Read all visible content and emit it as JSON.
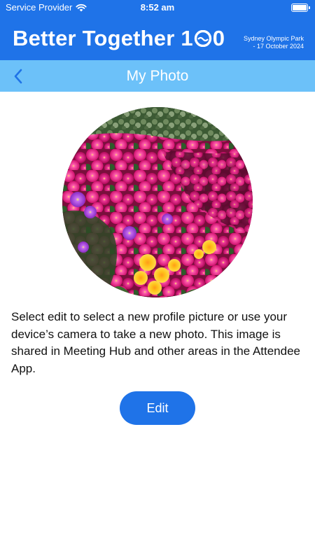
{
  "status_bar": {
    "carrier": "Service Provider",
    "time": "8:52 am",
    "wifi_icon": "wifi-icon",
    "battery_icon": "battery-icon",
    "battery_level": 1.0
  },
  "brand": {
    "title": "Better Together 1",
    "title_suffix": "0",
    "venue": "Sydney Olympic Park",
    "date": "- 17 October 2024",
    "logo_wave_icon": "wave-logo-icon"
  },
  "nav": {
    "title": "My Photo",
    "back_icon": "chevron-left-icon"
  },
  "profile_photo": {
    "description": "Profile photo of pink and purple pigface flowers with yellow blooms"
  },
  "description_text": "Select edit to select a new profile picture or use your device’s camera to take a new photo. This image is shared in Meeting Hub and other areas in the Attendee App.",
  "edit_button": {
    "label": "Edit"
  },
  "colors": {
    "primary_blue": "#1f73e8",
    "nav_light_blue": "#6cc1f9",
    "text": "#111111",
    "background": "#ffffff"
  }
}
